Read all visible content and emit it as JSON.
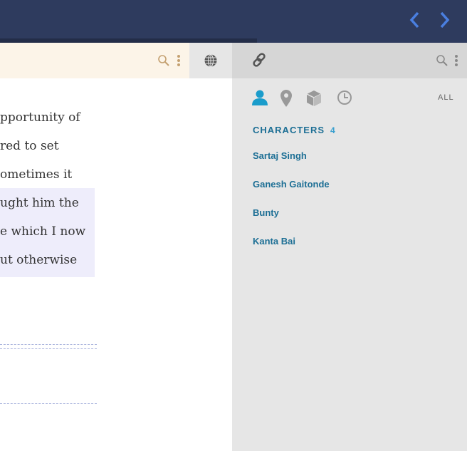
{
  "header": {
    "progress_fraction": 0.55,
    "prev_icon": "chevron-left-icon",
    "next_icon": "chevron-right-icon",
    "accent": "#4a7fe0",
    "background": "#2e3b5e"
  },
  "reader": {
    "lines": [
      "pportunity of",
      "red to set",
      "ometimes it",
      "ught him the",
      "e which I now",
      "ut otherwise"
    ],
    "highlight_color": "#eeedfb"
  },
  "panel": {
    "filters": [
      "person-icon",
      "map-pin-icon",
      "cube-icon",
      "clock-icon"
    ],
    "all_label": "ALL",
    "section_title": "CHARACTERS",
    "section_count": "4",
    "characters": [
      "Sartaj Singh",
      "Ganesh Gaitonde",
      "Bunty",
      "Kanta Bai"
    ],
    "text_color": "#1d6f95"
  }
}
